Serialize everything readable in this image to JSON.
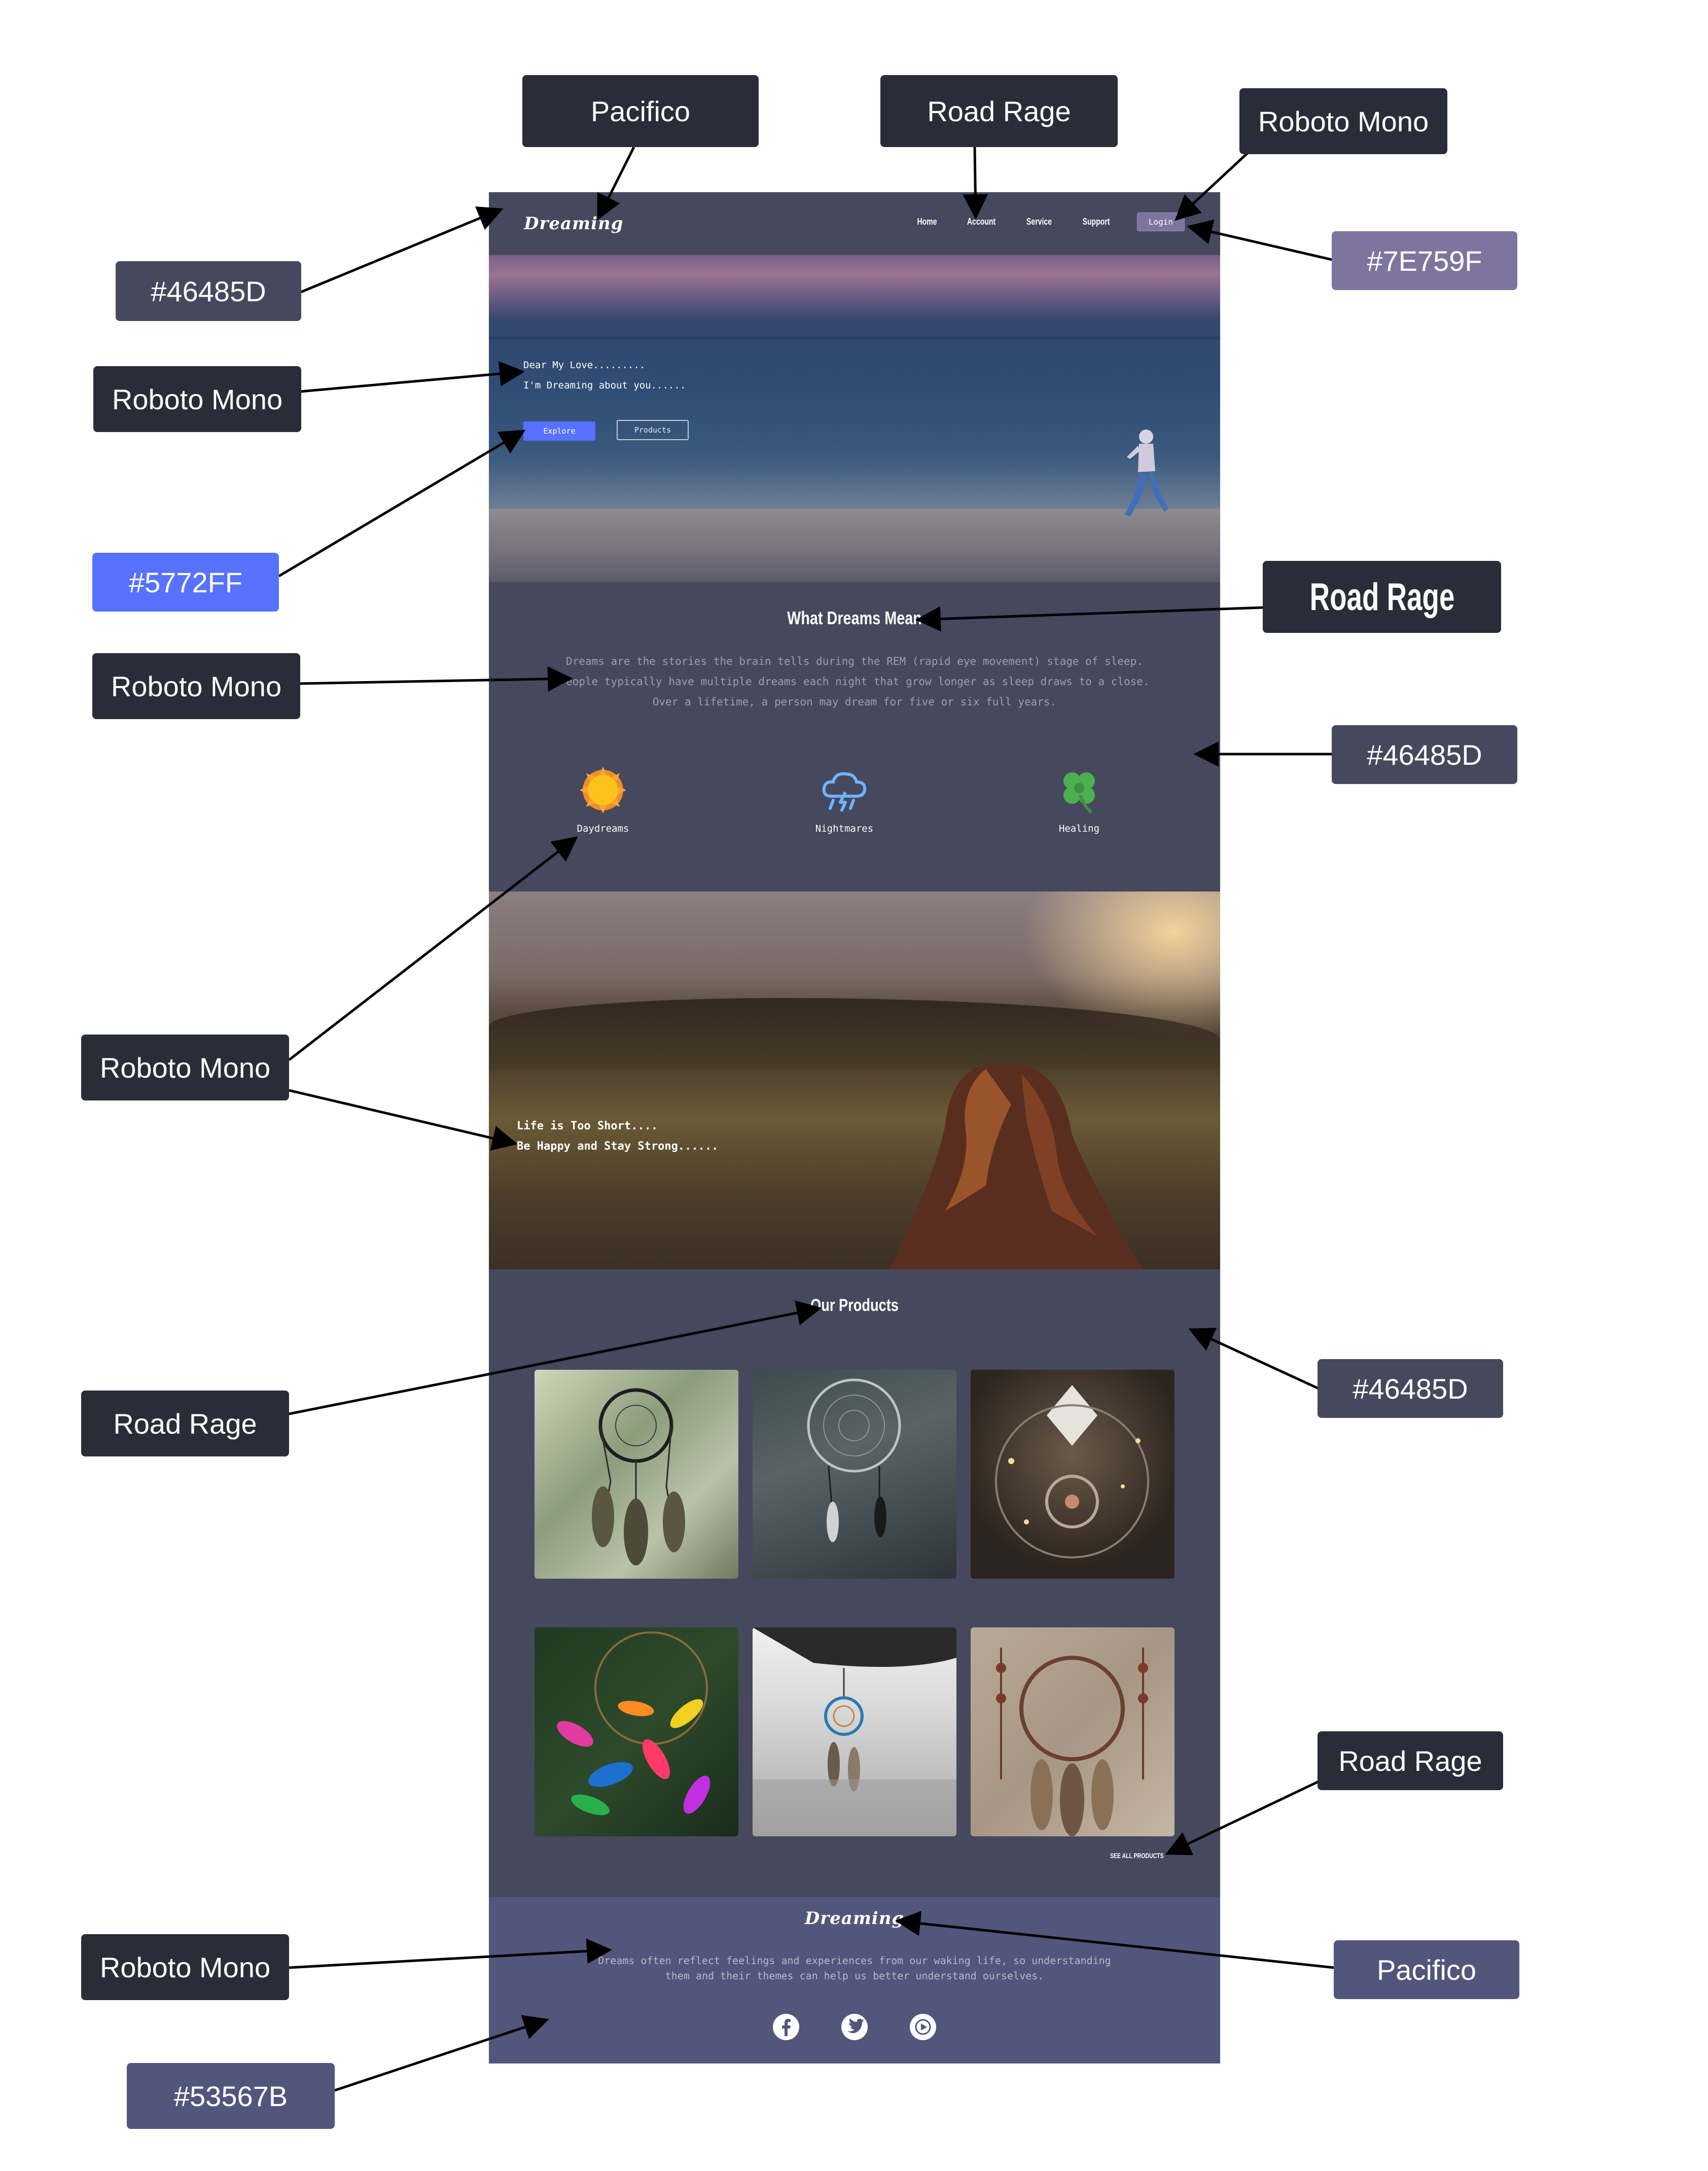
{
  "site": {
    "logo": "Dreaming",
    "nav": {
      "links": [
        "Home",
        "Account",
        "Service",
        "Support"
      ],
      "login_label": "Login"
    },
    "hero": {
      "line1": "Dear My Love.........",
      "line2": "I'm Dreaming about you......",
      "explore_label": "Explore",
      "products_label": "Products"
    },
    "dreams": {
      "title": "What Dreams Mean",
      "description": "Dreams are the stories the brain tells during the REM (rapid eye movement) stage of sleep. People typically have multiple dreams each night that grow longer as sleep draws to a close. Over a lifetime, a person may dream for five or six full years.",
      "features": [
        {
          "label": "Daydreams",
          "icon": "sun-icon"
        },
        {
          "label": "Nightmares",
          "icon": "storm-cloud-icon"
        },
        {
          "label": "Healing",
          "icon": "clover-icon"
        }
      ]
    },
    "banner": {
      "line1": "Life is Too Short....",
      "line2": "Be Happy and Stay Strong......"
    },
    "products": {
      "title": "Our Products",
      "see_all_label": "SEE ALL PRODUCTS",
      "items": [
        "dreamcatcher-1",
        "dreamcatcher-2",
        "dreamcatcher-3",
        "dreamcatcher-4",
        "dreamcatcher-5",
        "dreamcatcher-6"
      ]
    },
    "footer": {
      "logo": "Dreaming",
      "text": "Dreams often reflect feelings and experiences from our waking life, so understanding them and their themes can help us better understand ourselves.",
      "social_icons": [
        "facebook-icon",
        "twitter-icon",
        "youtube-icon"
      ]
    }
  },
  "annotations": {
    "pacifico_top": "Pacifico",
    "roadrage_top": "Road Rage",
    "roboto_top": "Roboto Mono",
    "color_nav": "#46485D",
    "color_login": "#7E759F",
    "roboto_hero": "Roboto Mono",
    "color_explore": "#5772FF",
    "roadrage_title": "Road Rage",
    "roboto_desc": "Roboto Mono",
    "color_dreams": "#46485D",
    "roboto_labels": "Roboto Mono",
    "roadrage_products": "Road Rage",
    "color_products": "#46485D",
    "roadrage_seeall": "Road Rage",
    "roboto_footer": "Roboto Mono",
    "pacifico_footer": "Pacifico",
    "color_footer": "#53567B"
  },
  "colors": {
    "nav_bg": "#46485d",
    "login_bg": "#7e759f",
    "explore_bg": "#5772ff",
    "footer_bg": "#53567b",
    "label_bg": "#2a2c38"
  }
}
